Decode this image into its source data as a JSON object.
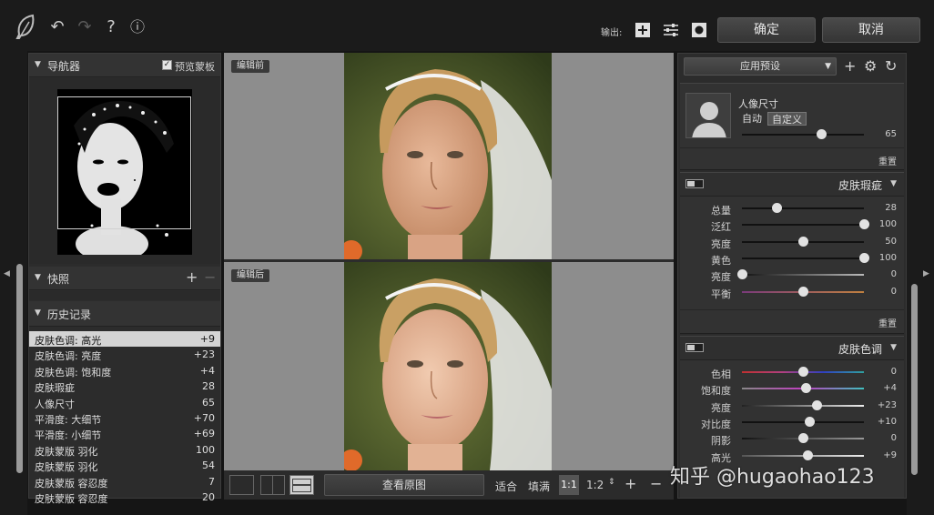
{
  "toolbar": {
    "export_label": "输出:",
    "ok_label": "确定",
    "cancel_label": "取消",
    "help_glyph": "?",
    "info_glyph": "ⓘ"
  },
  "navigator": {
    "title": "导航器",
    "preview_mask_label": "预览蒙板",
    "preview_mask_checked": true
  },
  "snapshots": {
    "title": "快照"
  },
  "history": {
    "title": "历史记录",
    "items": [
      {
        "label": "皮肤色调: 高光",
        "value": "+9",
        "selected": true
      },
      {
        "label": "皮肤色调: 亮度",
        "value": "+23"
      },
      {
        "label": "皮肤色调: 饱和度",
        "value": "+4"
      },
      {
        "label": "皮肤瑕疵",
        "value": "28"
      },
      {
        "label": "人像尺寸",
        "value": "65"
      },
      {
        "label": "平滑度: 大细节",
        "value": "+70"
      },
      {
        "label": "平滑度: 小细节",
        "value": "+69"
      },
      {
        "label": "皮肤蒙版 羽化",
        "value": "100"
      },
      {
        "label": "皮肤蒙版 羽化",
        "value": "54"
      },
      {
        "label": "皮肤蒙版 容忍度",
        "value": "7"
      },
      {
        "label": "皮肤蒙版 容忍度",
        "value": "20"
      }
    ]
  },
  "preview": {
    "before_label": "编辑前",
    "after_label": "编辑后"
  },
  "bottombar": {
    "view_original_label": "查看原图",
    "fit_label": "适合",
    "fill_label": "填满",
    "zoom_1_1": "1:1",
    "zoom_1_2": "1:2"
  },
  "presets": {
    "select_label": "应用预设"
  },
  "portrait_size": {
    "title": "人像尺寸",
    "auto_label": "自动",
    "custom_label": "自定义",
    "value": 65,
    "value_text": "65",
    "reset_label": "重置"
  },
  "skin_blemish": {
    "title": "皮肤瑕疵",
    "reset_label": "重置",
    "sliders": [
      {
        "label": "总量",
        "value": "28",
        "pos": 0.28
      },
      {
        "label": "泛红",
        "value": "100",
        "pos": 1.0
      },
      {
        "label": "亮度",
        "value": "50",
        "pos": 0.5
      },
      {
        "label": "黄色",
        "value": "100",
        "pos": 1.0
      },
      {
        "label": "亮度",
        "value": "0",
        "pos": 0.0
      },
      {
        "label": "平衡",
        "value": "0",
        "pos": 0.5
      }
    ]
  },
  "skin_tone": {
    "title": "皮肤色调",
    "sliders": [
      {
        "label": "色相",
        "value": "0",
        "pos": 0.5
      },
      {
        "label": "饱和度",
        "value": "+4",
        "pos": 0.52
      },
      {
        "label": "亮度",
        "value": "+23",
        "pos": 0.61
      },
      {
        "label": "对比度",
        "value": "+10",
        "pos": 0.55
      },
      {
        "label": "阴影",
        "value": "0",
        "pos": 0.5
      },
      {
        "label": "高光",
        "value": "+9",
        "pos": 0.54
      }
    ]
  },
  "watermark": "知乎 @hugaohao123"
}
